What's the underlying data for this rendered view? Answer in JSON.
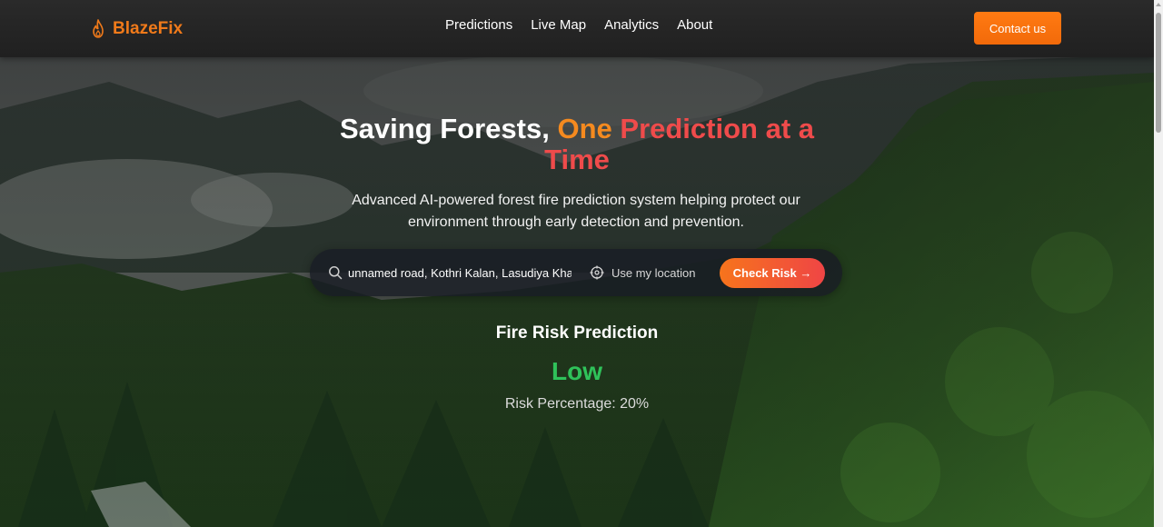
{
  "brand": {
    "name": "BlazeFix",
    "icon": "flame-icon",
    "color": "#f07a1a"
  },
  "nav": {
    "links": [
      "Predictions",
      "Live Map",
      "Analytics",
      "About"
    ],
    "contact_label": "Contact us"
  },
  "hero": {
    "title_part1": "Saving Forests,",
    "title_part2": "One",
    "title_part3": "Prediction at a Time",
    "subtitle": "Advanced AI-powered forest fire prediction system helping protect our environment through early detection and prevention."
  },
  "search": {
    "value": "unnamed road, Kothri Kalan, Lasudiya Khas",
    "location_label": "Use my location",
    "check_label": "Check Risk →"
  },
  "prediction": {
    "title": "Fire Risk Prediction",
    "level": "Low",
    "percentage_text": "Risk Percentage: 20%",
    "level_color": "#2fc25a"
  },
  "colors": {
    "accent_orange": "#f58a1f",
    "accent_red": "#ef4b4b",
    "button_orange": "#f26a0a"
  }
}
